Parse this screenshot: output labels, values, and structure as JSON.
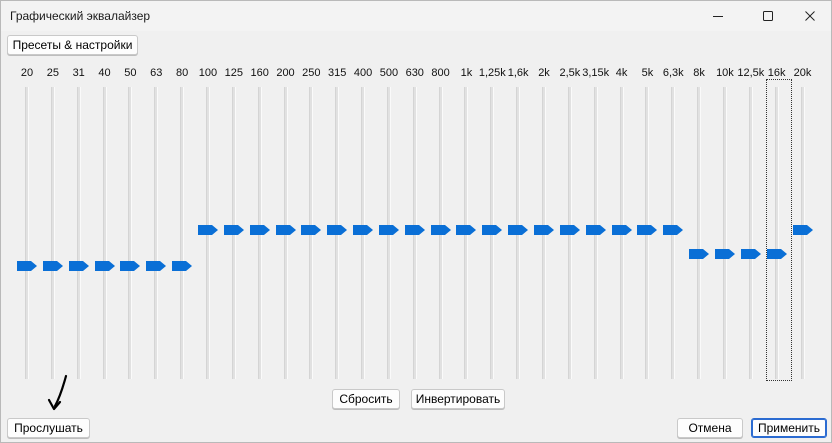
{
  "window": {
    "title": "Графический эквалайзер",
    "controls": [
      "minimize-icon",
      "maximize-icon",
      "close-icon"
    ]
  },
  "toolbar": {
    "presets_label": "Пресеты & настройки"
  },
  "bands": [
    {
      "label": "20",
      "level": -3
    },
    {
      "label": "25",
      "level": -3
    },
    {
      "label": "31",
      "level": -3
    },
    {
      "label": "40",
      "level": -3
    },
    {
      "label": "50",
      "level": -3
    },
    {
      "label": "63",
      "level": -3
    },
    {
      "label": "80",
      "level": -3
    },
    {
      "label": "100",
      "level": 0
    },
    {
      "label": "125",
      "level": 0
    },
    {
      "label": "160",
      "level": 0
    },
    {
      "label": "200",
      "level": 0
    },
    {
      "label": "250",
      "level": 0
    },
    {
      "label": "315",
      "level": 0
    },
    {
      "label": "400",
      "level": 0
    },
    {
      "label": "500",
      "level": 0
    },
    {
      "label": "630",
      "level": 0
    },
    {
      "label": "800",
      "level": 0
    },
    {
      "label": "1k",
      "level": 0
    },
    {
      "label": "1,25k",
      "level": 0
    },
    {
      "label": "1,6k",
      "level": 0
    },
    {
      "label": "2k",
      "level": 0
    },
    {
      "label": "2,5k",
      "level": 0
    },
    {
      "label": "3,15k",
      "level": 0
    },
    {
      "label": "4k",
      "level": 0
    },
    {
      "label": "5k",
      "level": 0
    },
    {
      "label": "6,3k",
      "level": 0
    },
    {
      "label": "8k",
      "level": -2
    },
    {
      "label": "10k",
      "level": -2
    },
    {
      "label": "12,5k",
      "level": -2
    },
    {
      "label": "16k",
      "level": -2
    },
    {
      "label": "20k",
      "level": 0
    }
  ],
  "focused_band": "16k",
  "actions": {
    "reset_label": "Сбросить",
    "invert_label": "Инвертировать",
    "listen_label": "Прослушать",
    "cancel_label": "Отмена",
    "apply_label": "Применить"
  },
  "colors": {
    "thumb": "#0a6fd6",
    "accent": "#2b6bd1"
  }
}
